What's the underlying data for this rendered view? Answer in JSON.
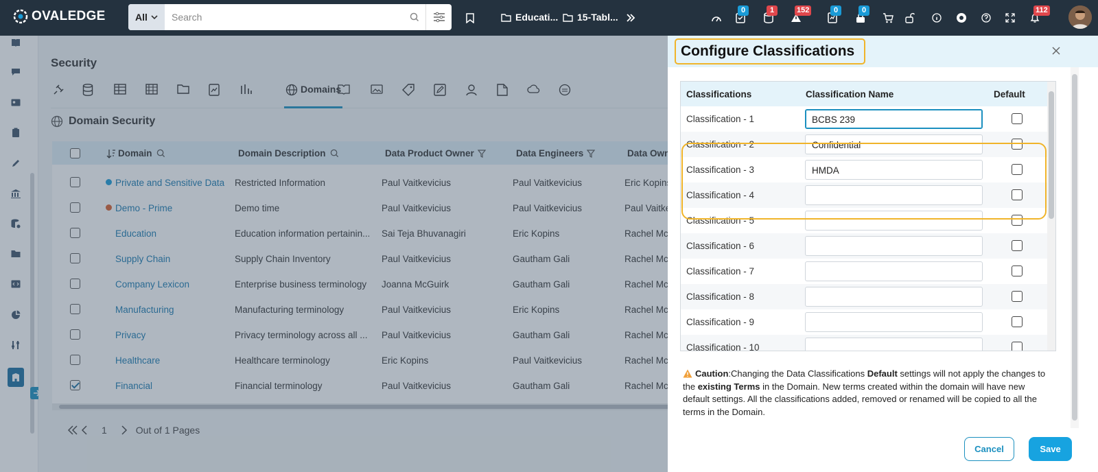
{
  "app": {
    "logo_text": "OVALEDGE"
  },
  "search": {
    "scope": "All",
    "placeholder": "Search"
  },
  "breadcrumbs": [
    {
      "label": "Educati..."
    },
    {
      "label": "15-Tabl..."
    }
  ],
  "badges": {
    "b1": "0",
    "b2": "1",
    "b3": "152",
    "b4": "0",
    "b5": "0",
    "notifications": "112"
  },
  "page": {
    "title": "Security",
    "active_tab": "Domains",
    "section_title": "Domain Security"
  },
  "grid": {
    "columns": [
      "Domain",
      "Domain Description",
      "Data Product Owner",
      "Data Engineers",
      "Data Owne"
    ],
    "rows": [
      {
        "domain": "Private and Sensitive Data",
        "dot": "#1a9bd7",
        "description": "Restricted Information",
        "product_owner": "Paul Vaitkevicius",
        "engineers": "Paul Vaitkevicius",
        "owner": "Eric Kopins",
        "checked": false
      },
      {
        "domain": "Demo - Prime",
        "dot": "#d9602e",
        "description": "Demo time",
        "product_owner": "Paul Vaitkevicius",
        "engineers": "Paul Vaitkevicius",
        "owner": "Paul Vaitke",
        "checked": false
      },
      {
        "domain": "Education",
        "dot": "",
        "description": "Education information pertainin...",
        "product_owner": "Sai Teja Bhuvanagiri",
        "engineers": "Eric Kopins",
        "owner": "Rachel Mc",
        "checked": false
      },
      {
        "domain": "Supply Chain",
        "dot": "",
        "description": "Supply Chain Inventory",
        "product_owner": "Paul Vaitkevicius",
        "engineers": "Gautham Gali",
        "owner": "Rachel Mc",
        "checked": false
      },
      {
        "domain": "Company Lexicon",
        "dot": "",
        "description": "Enterprise business terminology",
        "product_owner": "Joanna McGuirk",
        "engineers": "Gautham Gali",
        "owner": "Rachel Mc",
        "checked": false
      },
      {
        "domain": "Manufacturing",
        "dot": "",
        "description": "Manufacturing terminology",
        "product_owner": "Paul Vaitkevicius",
        "engineers": "Eric Kopins",
        "owner": "Rachel Mc",
        "checked": false
      },
      {
        "domain": "Privacy",
        "dot": "",
        "description": "Privacy terminology across all ...",
        "product_owner": "Paul Vaitkevicius",
        "engineers": "Gautham Gali",
        "owner": "Rachel Mc",
        "checked": false
      },
      {
        "domain": "Healthcare",
        "dot": "",
        "description": "Healthcare terminology",
        "product_owner": "Eric Kopins",
        "engineers": "Paul Vaitkevicius",
        "owner": "Rachel Mc",
        "checked": false
      },
      {
        "domain": "Financial",
        "dot": "",
        "description": "Financial terminology",
        "product_owner": "Paul Vaitkevicius",
        "engineers": "Gautham Gali",
        "owner": "Rachel Mc",
        "checked": true
      }
    ]
  },
  "pager": {
    "current": "1",
    "label": "Out of 1 Pages"
  },
  "dialog": {
    "title": "Configure Classifications",
    "headers": {
      "classifications": "Classifications",
      "name": "Classification Name",
      "default": "Default"
    },
    "rows": [
      {
        "label": "Classification - 1",
        "value": "BCBS 239"
      },
      {
        "label": "Classification - 2",
        "value": "Confidential"
      },
      {
        "label": "Classification - 3",
        "value": "HMDA"
      },
      {
        "label": "Classification - 4",
        "value": ""
      },
      {
        "label": "Classification - 5",
        "value": ""
      },
      {
        "label": "Classification - 6",
        "value": ""
      },
      {
        "label": "Classification - 7",
        "value": ""
      },
      {
        "label": "Classification - 8",
        "value": ""
      },
      {
        "label": "Classification - 9",
        "value": ""
      },
      {
        "label": "Classification - 10",
        "value": ""
      }
    ],
    "caution": {
      "prefix": "Caution",
      "t1": ":Changing the Data Classifications ",
      "b1": "Default",
      "t2": " settings will not apply the changes to the ",
      "b2": "existing Terms",
      "t3": " in the Domain. New terms created within the domain will have new default settings. All the classifications added, removed or renamed will be copied to all the terms in the Domain."
    },
    "cancel_label": "Cancel",
    "save_label": "Save"
  },
  "colors": {
    "accent": "#1a8fbf",
    "highlight": "#f0b429",
    "topbar": "#24323f"
  }
}
